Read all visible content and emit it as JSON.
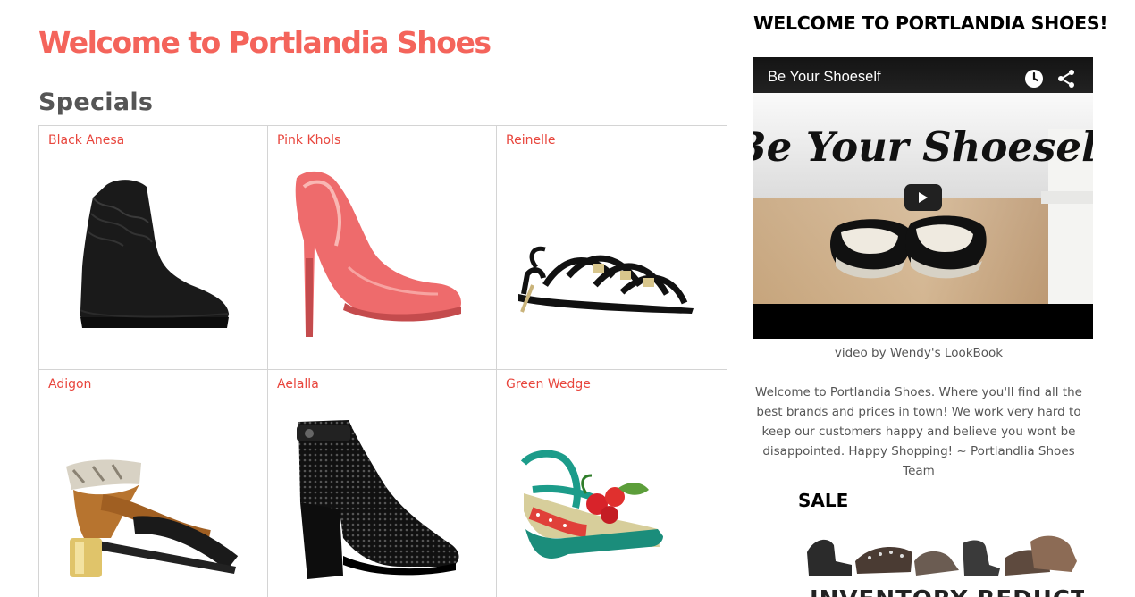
{
  "main": {
    "title": "Welcome to Portlandia Shoes",
    "specials_heading": "Specials",
    "products": [
      {
        "name": "Black Anesa",
        "icon": "black-ankle-boot"
      },
      {
        "name": "Pink Khols",
        "icon": "pink-pump"
      },
      {
        "name": "Reinelle",
        "icon": "black-sandal"
      },
      {
        "name": "Adigon",
        "icon": "block-heel-sandal"
      },
      {
        "name": "Aelalla",
        "icon": "black-perforated-heel"
      },
      {
        "name": "Green Wedge",
        "icon": "green-wedge"
      }
    ]
  },
  "sidebar": {
    "title": "WELCOME TO PORTLANDIA SHOES!",
    "video": {
      "title": "Be Your Shoeself",
      "art_text": "Be Your Shoeself"
    },
    "caption": "video by Wendy's LookBook",
    "welcome_text": "Welcome to Portlandia Shoes. Where you'll find all the best brands and prices in town! We work very hard to keep our customers happy and believe you wont be disappointed. Happy Shopping! ~ Portlandlia Shoes Team",
    "sale_title": "SALE",
    "sale_banner_text": "INVENTORY REDUCTION"
  },
  "colors": {
    "title": "#f4645b",
    "product_name": "#e8453c",
    "specials": "#555555"
  }
}
